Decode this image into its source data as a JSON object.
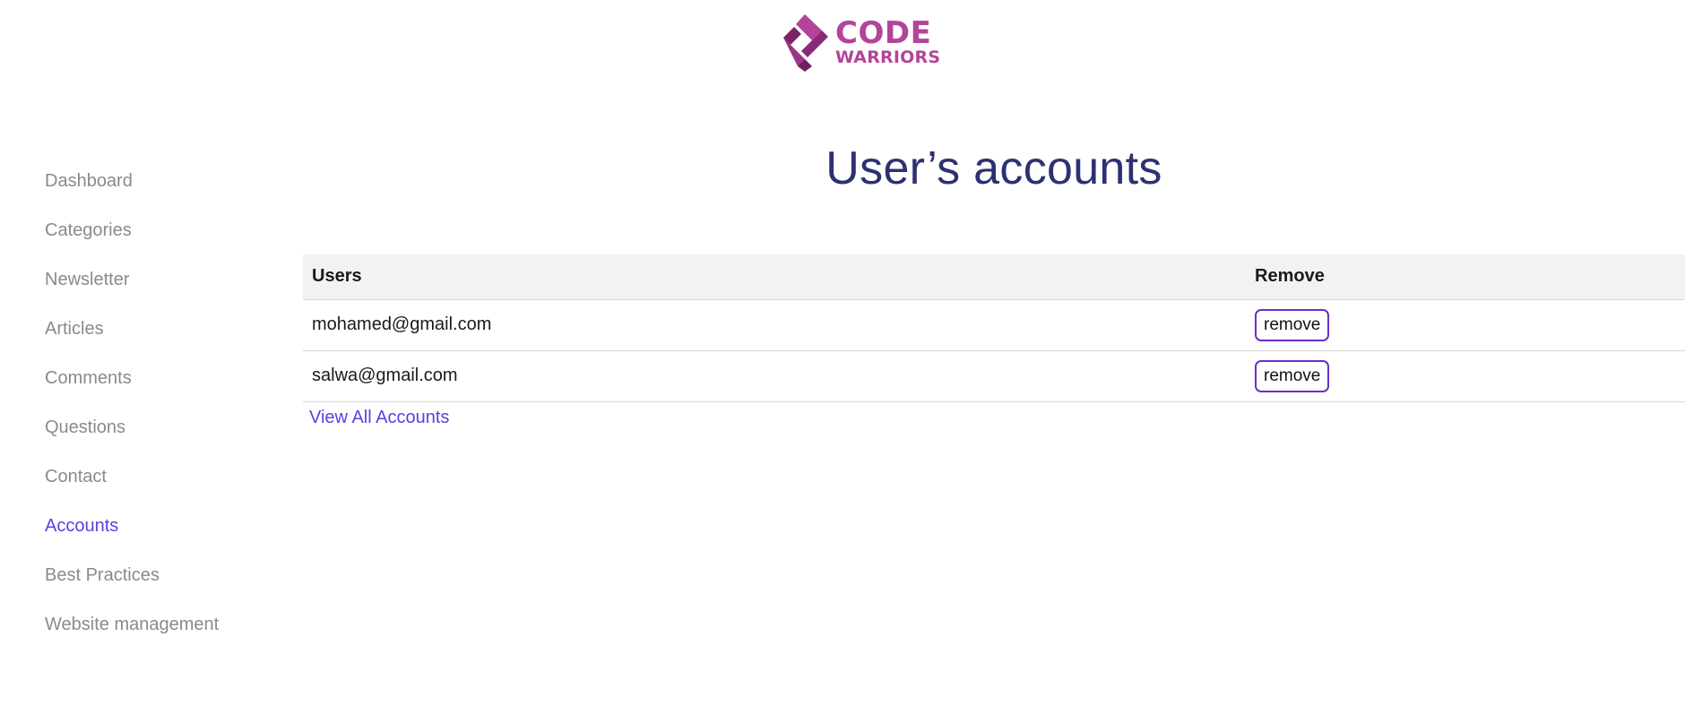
{
  "brand": {
    "line1": "CODE",
    "line2": "WARRIORS",
    "color": "#b2449a",
    "mark_icon": "code-warriors-logo-icon"
  },
  "sidebar": {
    "items": [
      {
        "label": "Dashboard",
        "active": false
      },
      {
        "label": "Categories",
        "active": false
      },
      {
        "label": "Newsletter",
        "active": false
      },
      {
        "label": "Articles",
        "active": false
      },
      {
        "label": "Comments",
        "active": false
      },
      {
        "label": "Questions",
        "active": false
      },
      {
        "label": "Contact",
        "active": false
      },
      {
        "label": "Accounts",
        "active": true
      },
      {
        "label": "Best Practices",
        "active": false
      },
      {
        "label": "Website management",
        "active": false
      }
    ],
    "active_color": "#5b3fe0",
    "inactive_color": "#8a8a8a"
  },
  "main": {
    "title": "User’s accounts",
    "table": {
      "headers": [
        "Users",
        "Remove"
      ],
      "rows": [
        {
          "user": "mohamed@gmail.com",
          "action": "remove"
        },
        {
          "user": "salwa@gmail.com",
          "action": "remove"
        }
      ]
    },
    "view_all_label": "View All Accounts"
  },
  "colors": {
    "title": "#2c3171",
    "link": "#5b3fe0",
    "button_border": "#6a2fc8",
    "header_bg": "#f2f2f2"
  }
}
